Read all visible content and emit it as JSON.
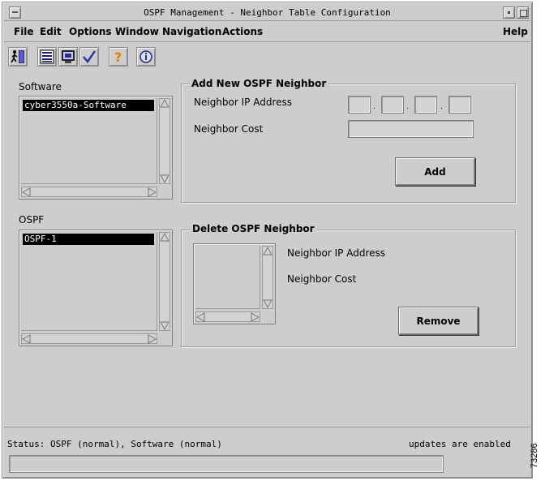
{
  "window": {
    "title": "OSPF Management - Neighbor Table Configuration"
  },
  "menu": {
    "file": "File",
    "edit": "Edit",
    "options": "Options",
    "window": "Window",
    "navigation": "Navigation",
    "actions": "Actions",
    "help": "Help"
  },
  "toolbar": {
    "icons": [
      "exit-icon",
      "list-icon",
      "monitor-icon",
      "check-icon",
      "help-question-icon",
      "info-icon"
    ]
  },
  "software": {
    "label": "Software",
    "selected": "cyber3550a-Software"
  },
  "ospf": {
    "label": "OSPF",
    "selected": "OSPF-1"
  },
  "add_group": {
    "title": "Add New OSPF Neighbor",
    "ip_label": "Neighbor IP Address",
    "cost_label": "Neighbor Cost",
    "ip_separator": ".",
    "add_button": "Add"
  },
  "delete_group": {
    "title": "Delete OSPF Neighbor",
    "ip_label": "Neighbor IP Address",
    "cost_label": "Neighbor Cost",
    "remove_button": "Remove"
  },
  "status": {
    "left": "Status: OSPF (normal), Software (normal)",
    "right": "updates are enabled"
  },
  "figure_id": "73286"
}
